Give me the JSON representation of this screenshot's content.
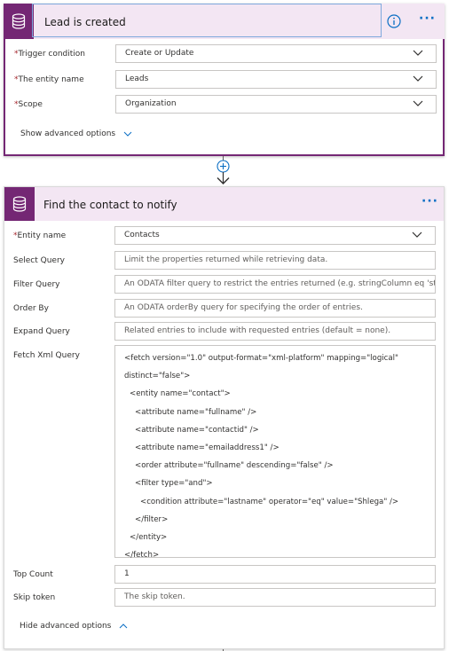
{
  "trigger": {
    "title": "Lead is created",
    "fields": [
      {
        "label": "Trigger condition",
        "value": "Create or Update"
      },
      {
        "label": "The entity name",
        "value": "Leads"
      },
      {
        "label": "Scope",
        "value": "Organization"
      }
    ],
    "advanced_toggle": "Show advanced options"
  },
  "action": {
    "title": "Find the contact to notify",
    "entity_name": {
      "label": "Entity name",
      "value": "Contacts"
    },
    "select_query": {
      "label": "Select Query",
      "placeholder": "Limit the properties returned while retrieving data."
    },
    "filter_query": {
      "label": "Filter Query",
      "placeholder": "An ODATA filter query to restrict the entries returned (e.g. stringColumn eq 'st"
    },
    "order_by": {
      "label": "Order By",
      "placeholder": "An ODATA orderBy query for specifying the order of entries."
    },
    "expand_query": {
      "label": "Expand Query",
      "placeholder": "Related entries to include with requested entries (default = none)."
    },
    "fetch_xml": {
      "label": "Fetch Xml Query",
      "lines": [
        "<fetch version=\"1.0\" output-format=\"xml-platform\" mapping=\"logical\"",
        "distinct=\"false\">",
        "  <entity name=\"contact\">",
        "    <attribute name=\"fullname\" />",
        "    <attribute name=\"contactid\" />",
        "    <attribute name=\"emailaddress1\" />",
        "    <order attribute=\"fullname\" descending=\"false\" />",
        "    <filter type=\"and\">",
        "      <condition attribute=\"lastname\" operator=\"eq\" value=\"Shlega\" />",
        "    </filter>",
        "  </entity>",
        "</fetch>"
      ]
    },
    "top_count": {
      "label": "Top Count",
      "value": "1"
    },
    "skip_token": {
      "label": "Skip token",
      "placeholder": "The skip token."
    },
    "advanced_toggle": "Hide advanced options"
  },
  "icons": {
    "connector": "database-icon",
    "info": "info-icon",
    "more": "more-options-icon",
    "add": "add-step-icon"
  },
  "colors": {
    "brand": "#742774",
    "header_bg": "#f3e6f3",
    "accent": "#0b6fc4",
    "required": "#a4262c"
  }
}
